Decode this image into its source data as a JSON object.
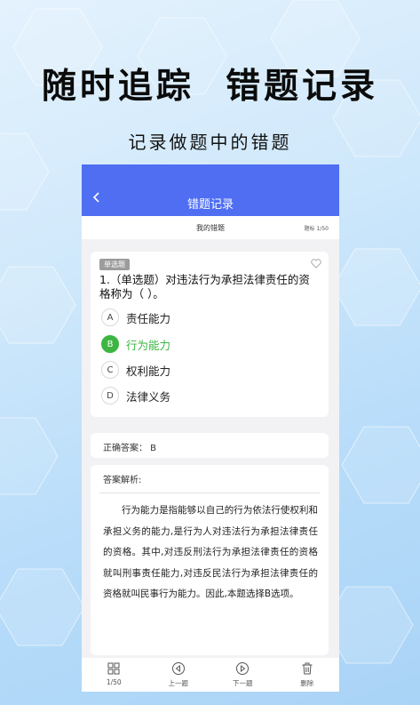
{
  "headline": "随时追踪  错题记录",
  "subline": "记录做题中的错题",
  "nav": {
    "title": "错题记录"
  },
  "subbar": {
    "title": "我的错题",
    "counter": "题标 1/50"
  },
  "question": {
    "type_tag": "单选题",
    "text": "1.（单选题）对违法行为承担法律责任的资格称为（ ）。",
    "options": [
      {
        "letter": "A",
        "label": "责任能力"
      },
      {
        "letter": "B",
        "label": "行为能力"
      },
      {
        "letter": "C",
        "label": "权利能力"
      },
      {
        "letter": "D",
        "label": "法律义务"
      }
    ]
  },
  "answer": {
    "text": "正确答案： B"
  },
  "analysis": {
    "title": "答案解析:",
    "text": "行为能力是指能够以自己的行为依法行使权利和承担义务的能力,是行为人对违法行为承担法律责任的资格。其中,对违反刑法行为承担法律责任的资格就叫刑事责任能力,对违反民法行为承担法律责任的资格就叫民事行为能力。因此,本题选择B选项。"
  },
  "tabbar": {
    "items": [
      {
        "label": "1/50",
        "icon": "grid-icon"
      },
      {
        "label": "上一题",
        "icon": "prev-icon"
      },
      {
        "label": "下一题",
        "icon": "next-icon"
      },
      {
        "label": "删除",
        "icon": "trash-icon"
      }
    ]
  },
  "colors": {
    "primary": "#4f6ef2",
    "correct": "#3db543"
  }
}
